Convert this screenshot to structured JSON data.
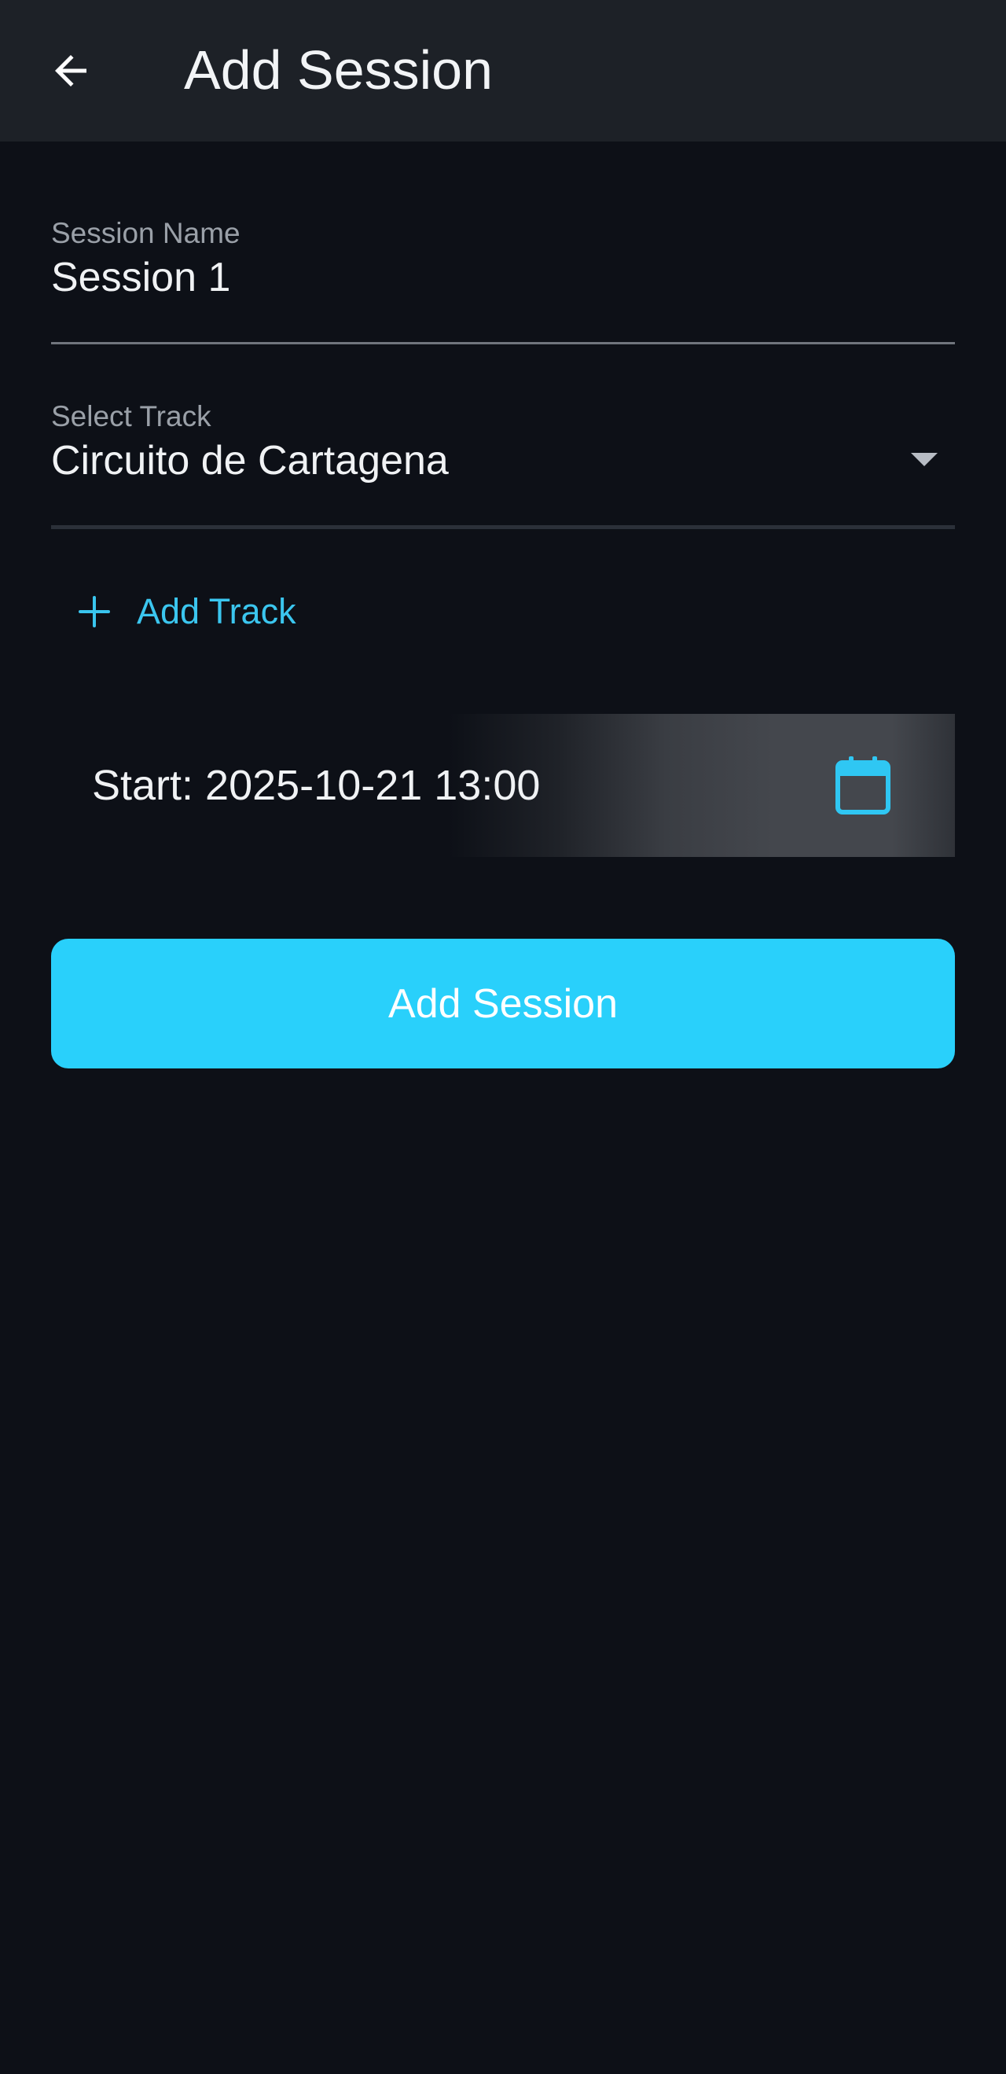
{
  "header": {
    "title": "Add Session",
    "back_icon": "arrow-left-icon"
  },
  "form": {
    "session_name": {
      "label": "Session Name",
      "value": "Session 1"
    },
    "track": {
      "label": "Select Track",
      "value": "Circuito de Cartagena",
      "icon": "dropdown-caret-icon"
    },
    "add_track": {
      "label": "Add Track",
      "icon": "plus-icon"
    },
    "start": {
      "text": "Start: 2025-10-21 13:00",
      "icon": "calendar-icon"
    },
    "submit": {
      "label": "Add Session"
    }
  },
  "colors": {
    "background": "#0d1017",
    "app_bar": "#1d2127",
    "accent": "#29d0fb",
    "link": "#3bc6ef"
  }
}
